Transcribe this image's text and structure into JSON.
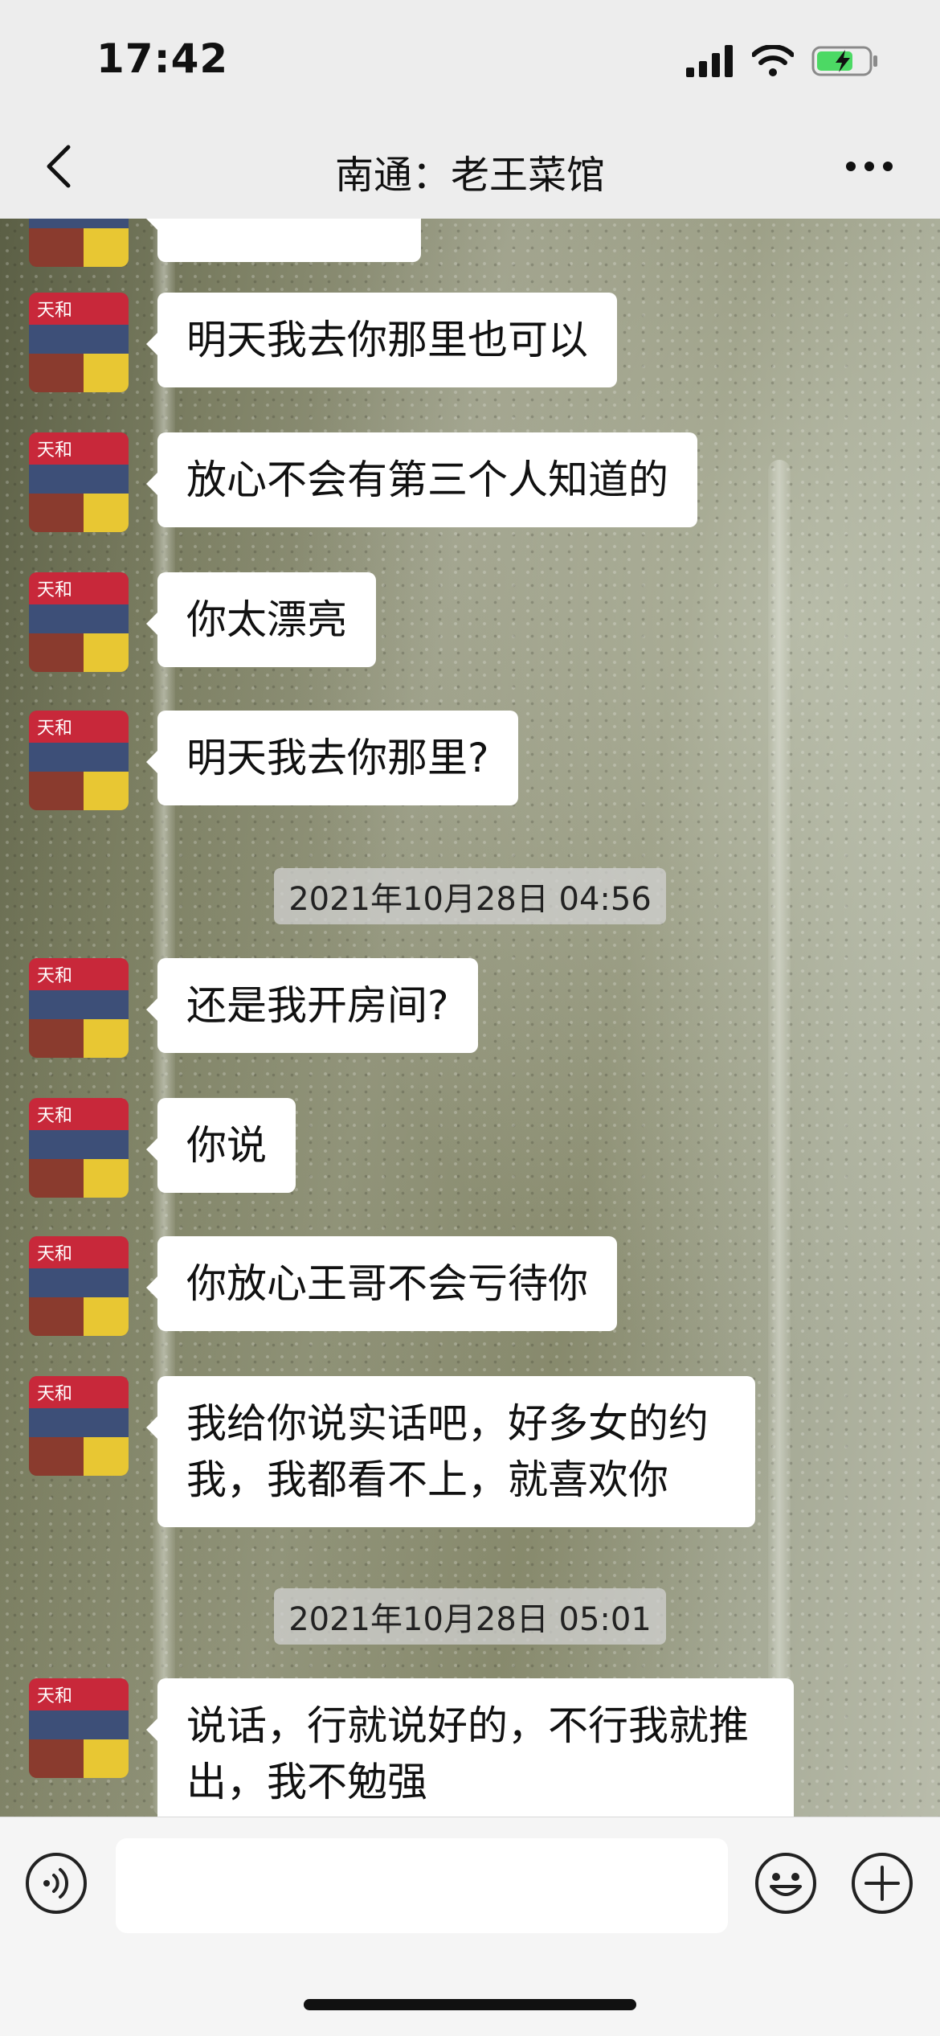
{
  "status_bar": {
    "time": "17:42"
  },
  "nav": {
    "title": "南通：老王菜馆"
  },
  "avatar_sign": "天和",
  "messages": [
    {
      "text": ""
    },
    {
      "text": "明天我去你那里也可以"
    },
    {
      "text": "放心不会有第三个人知道的"
    },
    {
      "text": "你太漂亮"
    },
    {
      "text": "明天我去你那里?"
    },
    {
      "text": "还是我开房间?"
    },
    {
      "text": "你说"
    },
    {
      "text": "你放心王哥不会亏待你"
    },
    {
      "text": "我给你说实话吧，好多女的约我，我都看不上，就喜欢你"
    },
    {
      "text": "说话，行就说好的，不行我就推出，我不勉强"
    }
  ],
  "timestamps": [
    "2021年10月28日 04:56",
    "2021年10月28日 05:01"
  ],
  "input": {
    "value": "",
    "placeholder": ""
  },
  "icons": {
    "back": "chevron-left-icon",
    "more": "more-dots-icon",
    "voice": "voice-icon",
    "emoji": "emoji-icon",
    "plus": "plus-icon"
  }
}
